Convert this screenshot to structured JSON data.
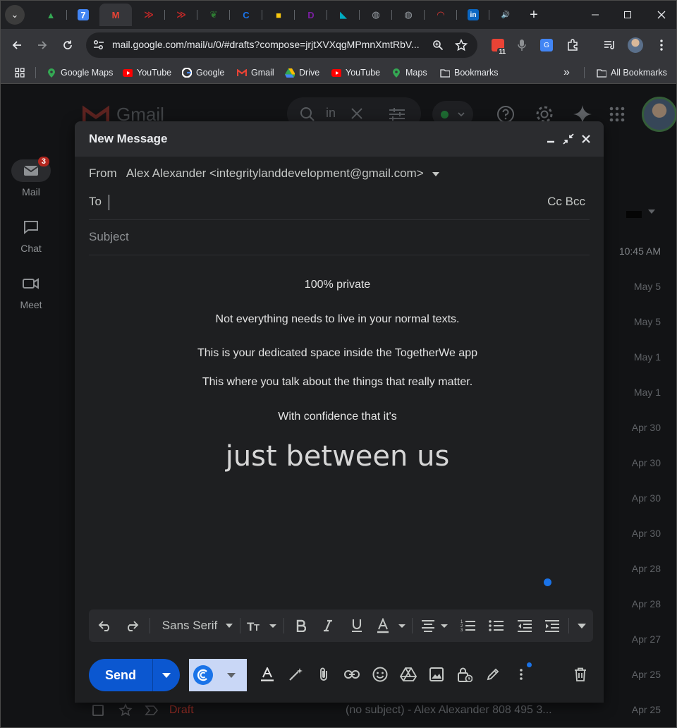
{
  "browser": {
    "tabs": [
      {
        "name": "Google Drive",
        "color": "#34a853",
        "glyph": "▲"
      },
      {
        "name": "Google Calendar",
        "color": "#4285f4",
        "glyph": "7"
      },
      {
        "name": "Gmail",
        "color": "#ea4335",
        "glyph": "M"
      },
      {
        "name": "Red arrows app",
        "color": "#c62828",
        "glyph": "≫"
      },
      {
        "name": "Red arrows app 2",
        "color": "#c62828",
        "glyph": "≫"
      },
      {
        "name": "Green leaf",
        "color": "#2e7d32",
        "glyph": "❦"
      },
      {
        "name": "Blue circle",
        "color": "#1a73e8",
        "glyph": "C"
      },
      {
        "name": "Yellow app",
        "color": "#f9c80e",
        "glyph": "■"
      },
      {
        "name": "Purple app",
        "color": "#7b1fa2",
        "glyph": "D"
      },
      {
        "name": "Teal app",
        "color": "#00acc1",
        "glyph": "◣"
      },
      {
        "name": "Globe",
        "color": "#9aa0a6",
        "glyph": "◍"
      },
      {
        "name": "Globe 2",
        "color": "#9aa0a6",
        "glyph": "◍"
      },
      {
        "name": "Rainbow",
        "color": "#e53935",
        "glyph": "◠"
      },
      {
        "name": "LinkedIn",
        "color": "#0a66c2",
        "glyph": "in"
      },
      {
        "name": "Audio",
        "color": "#e8eaed",
        "glyph": "🔊"
      }
    ],
    "new_tab": "+",
    "address": "mail.google.com/mail/u/0/#drafts?compose=jrjtXVXqgMPmnXmtRbV...",
    "calendar_badge": "11",
    "bookmarks": [
      {
        "label": "Google Maps",
        "icon": "map-pin",
        "color": "#34a853"
      },
      {
        "label": "YouTube",
        "icon": "youtube",
        "color": "#ff0000"
      },
      {
        "label": "Google",
        "icon": "google",
        "color": "#4285f4"
      },
      {
        "label": "Gmail",
        "icon": "gmail",
        "color": "#ea4335"
      },
      {
        "label": "Drive",
        "icon": "drive",
        "color": "#fbbc04"
      },
      {
        "label": "YouTube",
        "icon": "youtube",
        "color": "#ff0000"
      },
      {
        "label": "Maps",
        "icon": "map-pin",
        "color": "#34a853"
      },
      {
        "label": "Bookmarks",
        "icon": "folder",
        "color": "#e8eaed"
      }
    ],
    "more_bookmarks": "»",
    "all_bookmarks": "All Bookmarks"
  },
  "gmail": {
    "logo": "Gmail",
    "search_chip": "in",
    "rail": [
      {
        "label": "Mail",
        "badge": "3"
      },
      {
        "label": "Chat",
        "badge": ""
      },
      {
        "label": "Meet",
        "badge": ""
      }
    ],
    "dates": [
      "10:45 AM",
      "May 5",
      "May 5",
      "May 1",
      "May 1",
      "Apr 30",
      "Apr 30",
      "Apr 30",
      "Apr 30",
      "Apr 28",
      "Apr 28",
      "Apr 27",
      "Apr 25",
      "Apr 25"
    ],
    "draft_row": {
      "label": "Draft",
      "snippet": "(no subject) - Alex Alexander 808 495 3..."
    }
  },
  "compose": {
    "title": "New Message",
    "from_label": "From",
    "from_value": "Alex Alexander <integritylanddevelopment@gmail.com>",
    "to_label": "To",
    "cc_bcc": "Cc Bcc",
    "subject_placeholder": "Subject",
    "body": [
      "100% private",
      "Not everything needs to live in your normal texts.",
      "This is your dedicated space inside the TogetherWe app",
      "This where you talk about the things that really matter.",
      "With confidence that it's"
    ],
    "headline": "just between us",
    "font_name": "Sans Serif",
    "send_label": "Send"
  }
}
